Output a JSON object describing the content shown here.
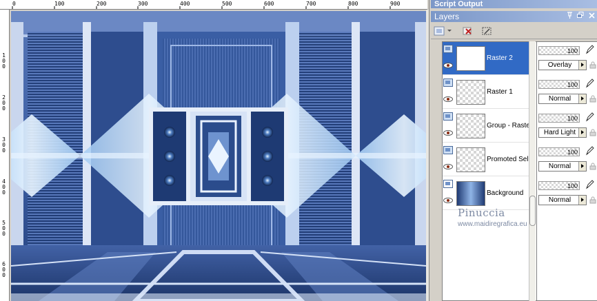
{
  "palettes": {
    "script_output_title": "Script Output",
    "layers_title": "Layers"
  },
  "ruler": {
    "top_labels": [
      "0",
      "100",
      "200",
      "300",
      "400",
      "500",
      "600",
      "700",
      "800",
      "900"
    ],
    "left_labels": [
      "1\n0\n0",
      "2\n0\n0",
      "3\n0\n0",
      "4\n0\n0",
      "5\n0\n0",
      "6\n0\n0"
    ]
  },
  "icons": {
    "pin": "pin-icon",
    "restore": "restore-icon",
    "close": "close-icon",
    "new_layer": "new-layer-icon",
    "delete_layer": "delete-layer-icon",
    "mask": "mask-icon",
    "visibility": "eye-icon",
    "edit": "pen-icon",
    "lock": "lock-icon"
  },
  "layers": [
    {
      "name": "Raster 2",
      "opacity": "100",
      "blend": "Overlay",
      "selected": true
    },
    {
      "name": "Raster 1",
      "opacity": "100",
      "blend": "Normal",
      "selected": false
    },
    {
      "name": "Group - Raster",
      "opacity": "100",
      "blend": "Hard Light",
      "selected": false
    },
    {
      "name": "Promoted Sele",
      "opacity": "100",
      "blend": "Normal",
      "selected": false
    },
    {
      "name": "Background",
      "opacity": "100",
      "blend": "Normal",
      "selected": false
    }
  ],
  "watermark": {
    "name": "Pinuccia",
    "url": "www.maidiregrafica.eu"
  },
  "colors": {
    "selection": "#316ac5",
    "palette_title": "#7b97c8",
    "image_dark": "#243f78",
    "image_light": "#cfe3ff"
  }
}
